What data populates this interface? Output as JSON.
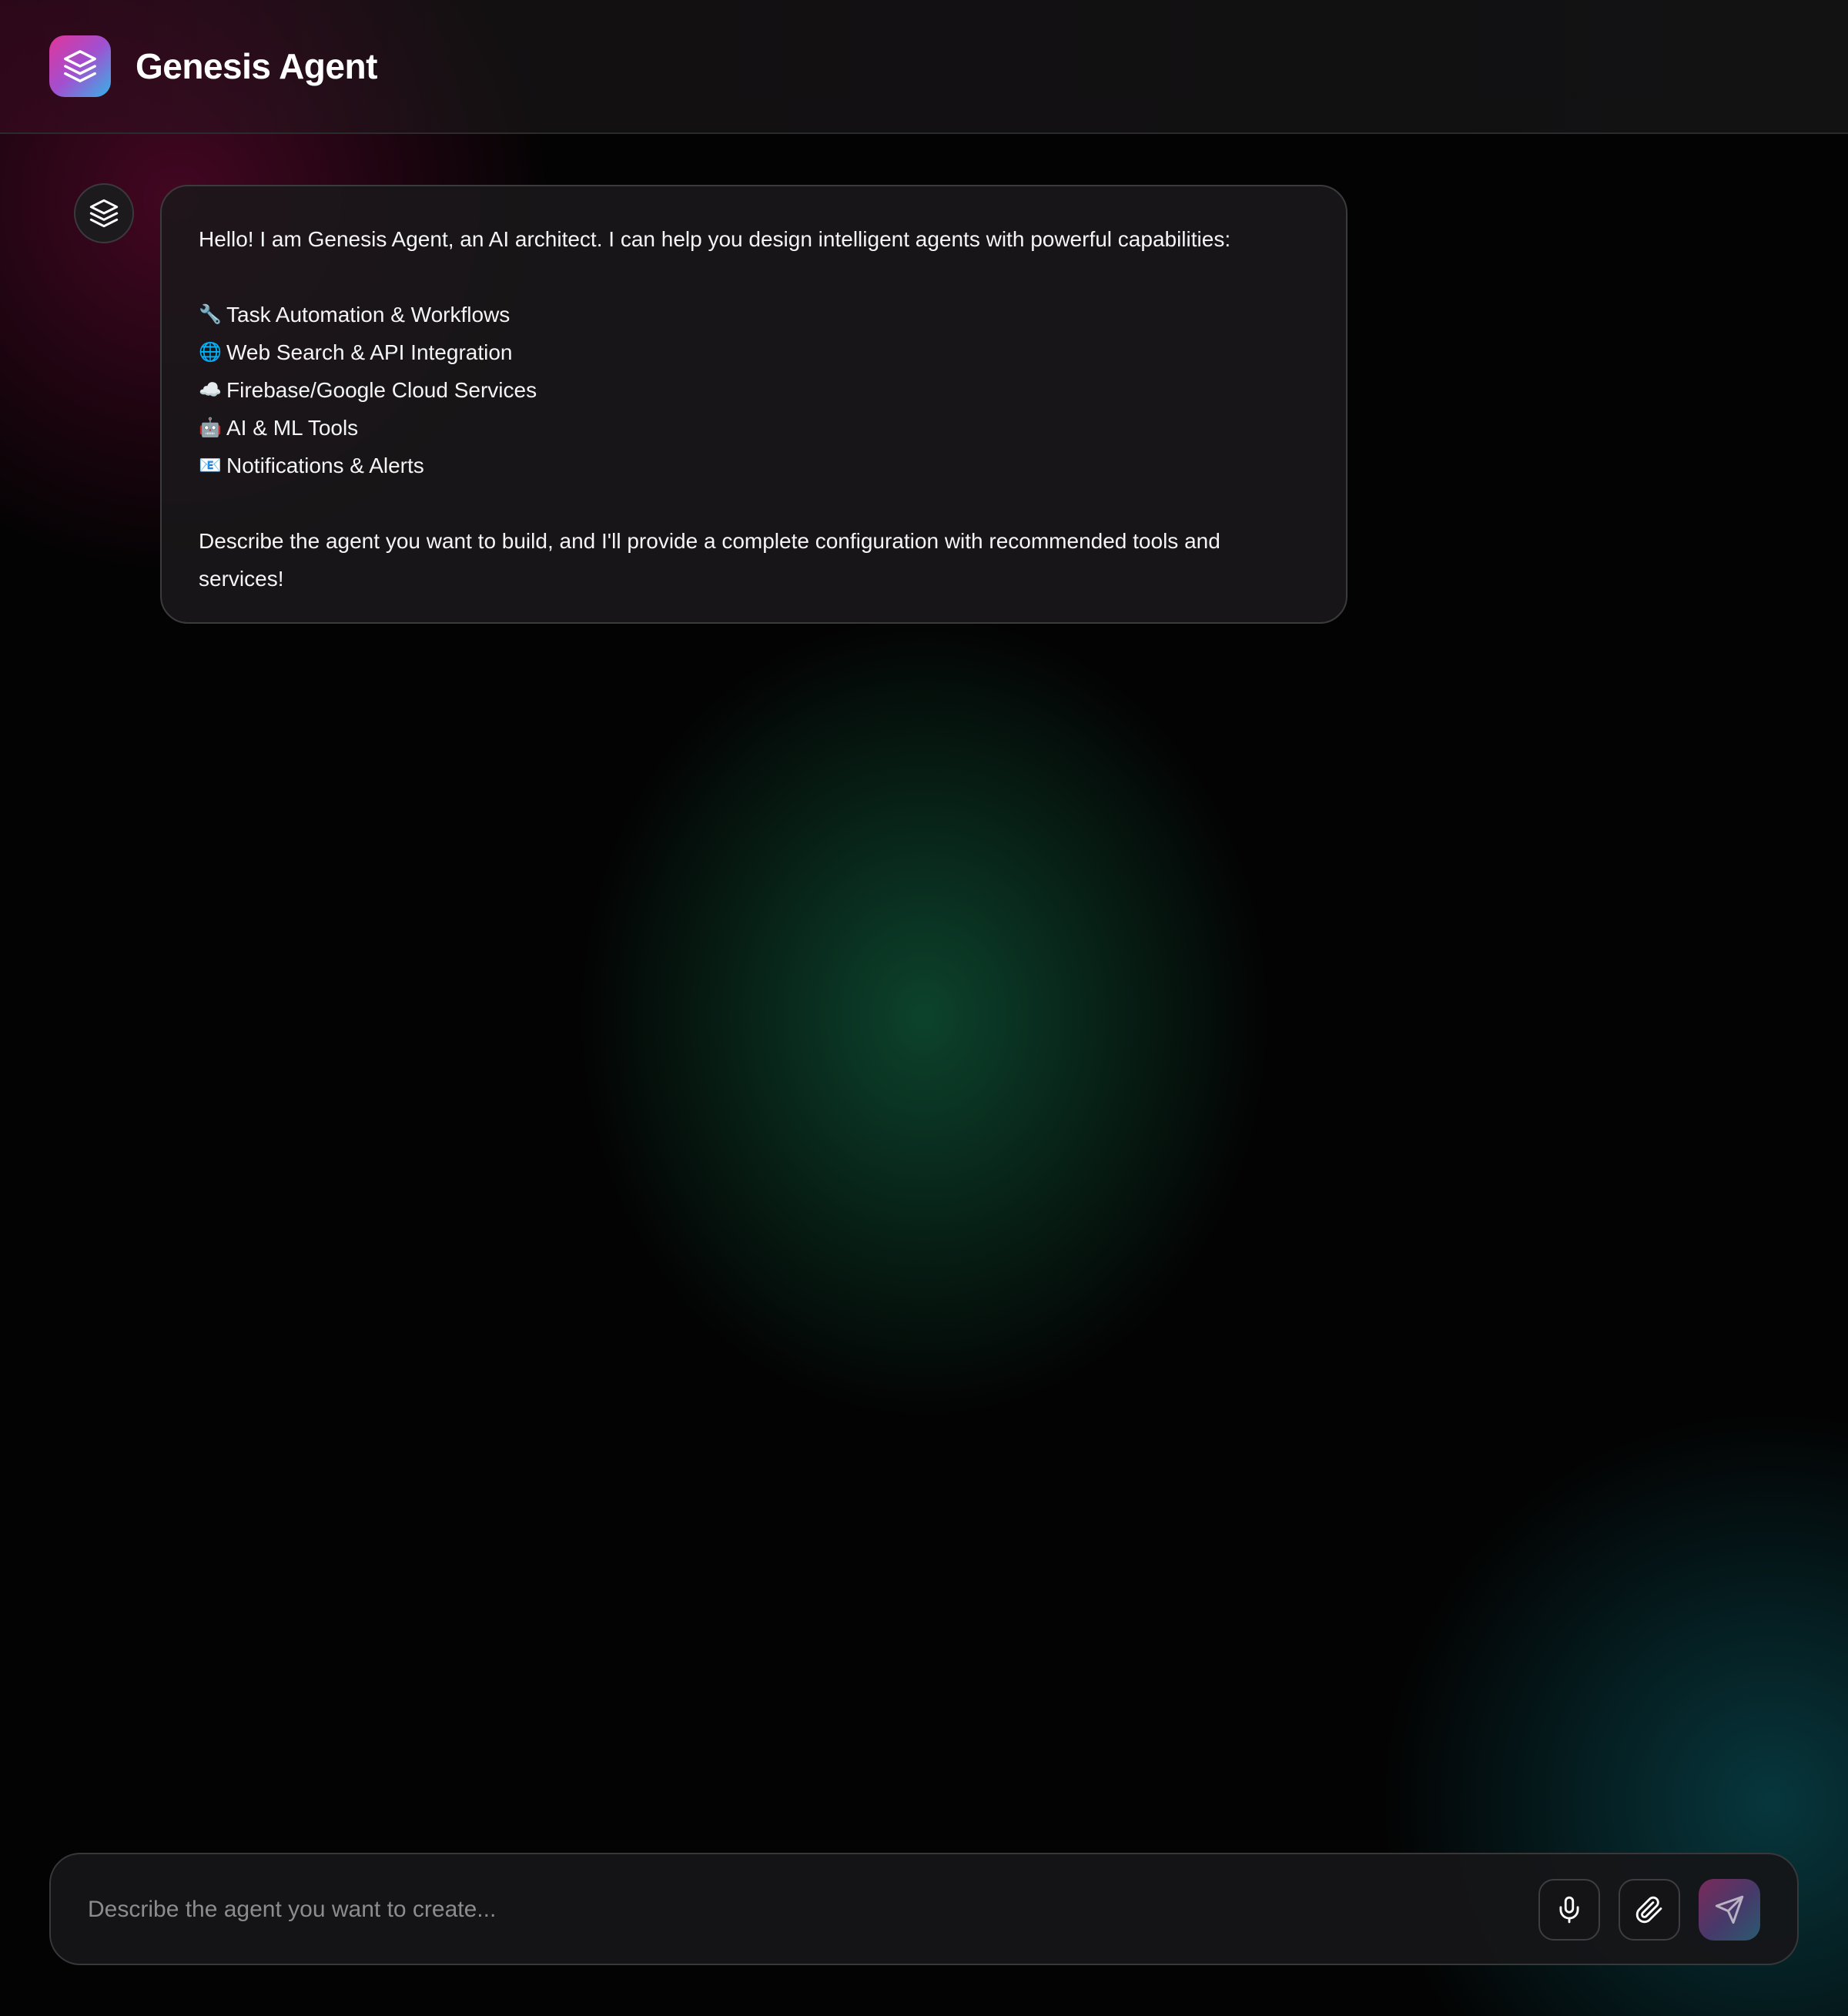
{
  "app": {
    "title": "Genesis Agent",
    "logo_icon": "layers-icon",
    "brand_gradient": [
      "#e0359a",
      "#a24fd0",
      "#35b3e6"
    ]
  },
  "chat": {
    "bot_avatar_icon": "layers-icon",
    "message": {
      "greeting": "Hello! I am Genesis Agent, an AI architect. I can help you design intelligent agents with powerful capabilities:",
      "capabilities": [
        {
          "icon": "🔧",
          "icon_name": "wrench-icon",
          "label": "Task Automation & Workflows"
        },
        {
          "icon": "🌐",
          "icon_name": "globe-icon",
          "label": "Web Search & API Integration"
        },
        {
          "icon": "☁️",
          "icon_name": "cloud-icon",
          "label": "Firebase/Google Cloud Services"
        },
        {
          "icon": "🤖",
          "icon_name": "robot-icon",
          "label": "AI & ML Tools"
        },
        {
          "icon": "📧",
          "icon_name": "email-icon",
          "label": "Notifications & Alerts"
        }
      ],
      "closing": "Describe the agent you want to build, and I'll provide a complete configuration with recommended tools and services!"
    }
  },
  "composer": {
    "placeholder": "Describe the agent you want to create...",
    "value": "",
    "mic_icon": "microphone-icon",
    "attach_icon": "paperclip-icon",
    "send_icon": "send-icon"
  }
}
